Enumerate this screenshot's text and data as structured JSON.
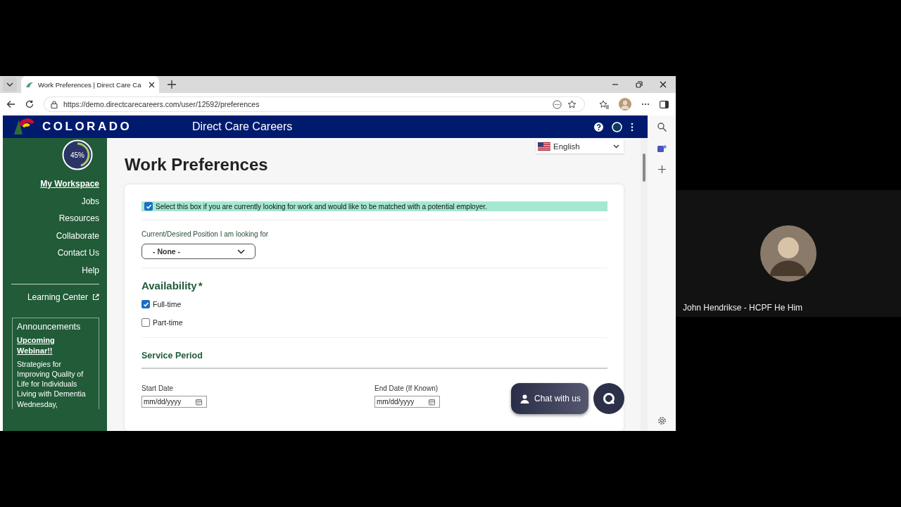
{
  "browser": {
    "tab_title": "Work Preferences | Direct Care Ca",
    "url": "https://demo.directcarecareers.com/user/12592/preferences"
  },
  "site": {
    "brand": "COLORADO",
    "title": "Direct Care Careers"
  },
  "profile_progress": {
    "reading": "45%",
    "level": 0.45
  },
  "nav": [
    {
      "label": "My Workspace",
      "selected": true
    },
    {
      "label": "Jobs",
      "selected": false
    },
    {
      "label": "Resources",
      "selected": false
    },
    {
      "label": "Collaborate",
      "selected": false
    },
    {
      "label": "Contact Us",
      "selected": false
    },
    {
      "label": "Help",
      "selected": false
    }
  ],
  "learning_center": "Learning Center",
  "announcements": {
    "title": "Announcements",
    "link": "Upcoming Webinar!!",
    "text": "Strategies for Improving Quality of Life for Individuals Living with Dementia Wednesday,"
  },
  "language": "English",
  "page_title": "Work Preferences",
  "match_checkbox": {
    "label": "Select this box if you are currently looking for work and would like to be matched with a potential employer.",
    "checked": true
  },
  "position": {
    "label": "Current/Desired Position I am looking for",
    "value": "- None -"
  },
  "availability": {
    "title": "Availability",
    "required_mark": "*",
    "options": [
      {
        "label": "Full-time",
        "checked": true
      },
      {
        "label": "Part-time",
        "checked": false
      }
    ]
  },
  "service_period": {
    "title": "Service Period",
    "fields": [
      {
        "label": "Start Date",
        "placeholder": "mm/dd/yyyy"
      },
      {
        "label": "End Date (If Known)",
        "placeholder": "mm/dd/yyyy"
      }
    ]
  },
  "chat_button": "Chat with us",
  "participant": {
    "name": "John Hendrikse - HCPF He Him"
  }
}
